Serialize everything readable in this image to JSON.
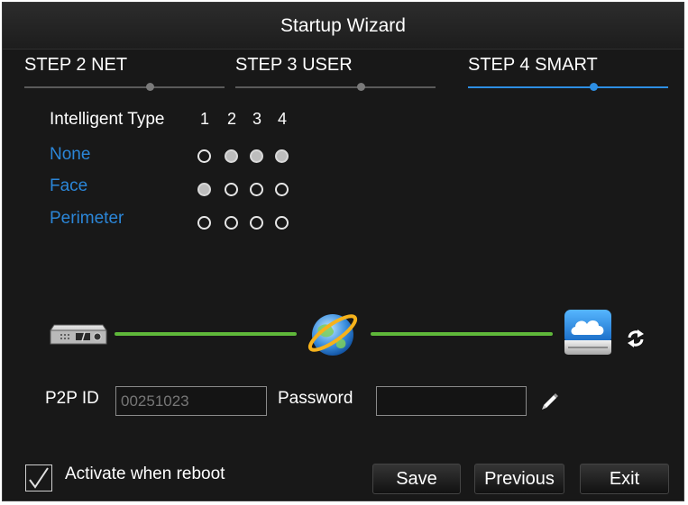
{
  "window": {
    "title": "Startup Wizard"
  },
  "steps": [
    {
      "label": "STEP 2 NET",
      "active": false
    },
    {
      "label": "STEP 3 USER",
      "active": false
    },
    {
      "label": "STEP 4 SMART",
      "active": true
    }
  ],
  "intelligent": {
    "header_label": "Intelligent Type",
    "columns": [
      "1",
      "2",
      "3",
      "4"
    ],
    "rows": [
      {
        "label": "None",
        "selected": [
          false,
          true,
          true,
          true
        ]
      },
      {
        "label": "Face",
        "selected": [
          true,
          false,
          false,
          false
        ]
      },
      {
        "label": "Perimeter",
        "selected": [
          false,
          false,
          false,
          false
        ]
      }
    ]
  },
  "connection": {
    "device_icon": "dvr-recorder-icon",
    "internet_icon": "internet-globe-icon",
    "cloud_icon": "cloud-server-icon",
    "refresh_icon": "refresh-icon",
    "line_color": "#5fb83a"
  },
  "p2p": {
    "id_label": "P2P ID",
    "id_value": "00251023",
    "password_label": "Password",
    "password_value": "",
    "edit_icon": "pencil-icon"
  },
  "activate": {
    "label": "Activate when reboot",
    "checked": true
  },
  "buttons": {
    "save": "Save",
    "previous": "Previous",
    "exit": "Exit"
  },
  "colors": {
    "accent": "#2d8fe4",
    "row_label": "#2b86d8",
    "background": "#181818"
  }
}
